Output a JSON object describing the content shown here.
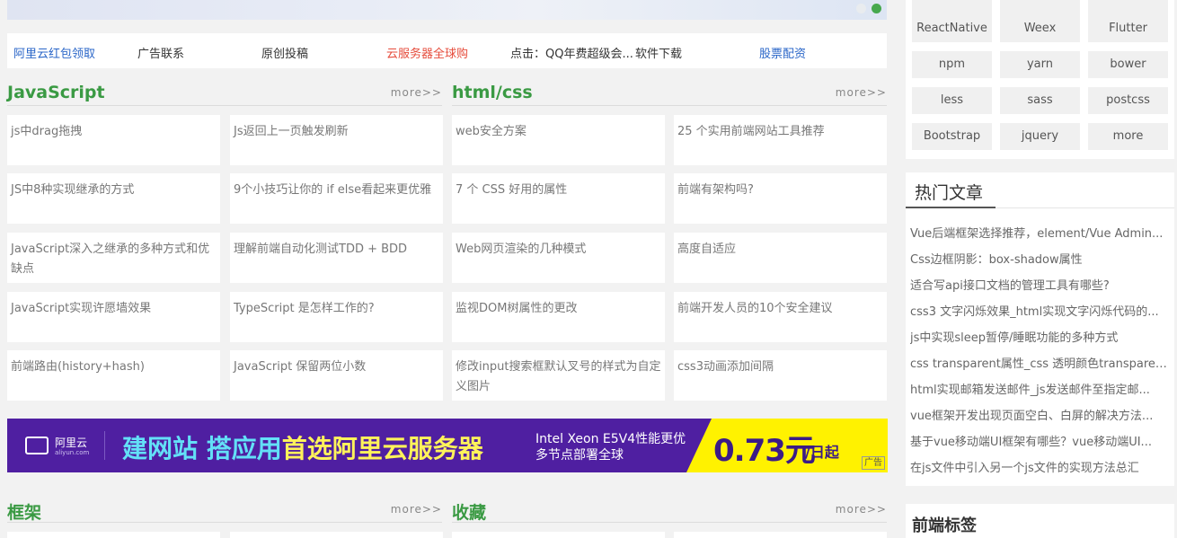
{
  "carousel": {
    "dots": 2,
    "active_dot": 2
  },
  "linkbar": {
    "links": [
      {
        "label": "阿里云红包领取",
        "color": "#2a66c8"
      },
      {
        "label": "广告联系",
        "color": "#333333"
      },
      {
        "label": "原创投稿",
        "color": "#333333"
      },
      {
        "label": "云服务器全球购",
        "color": "#e64c3c"
      },
      {
        "label": "点击：QQ年费超级会...",
        "color": "#333333"
      },
      {
        "label": "软件下载",
        "color": "#333333"
      },
      {
        "label": "股票配资",
        "color": "#2a66c8"
      }
    ]
  },
  "sections": {
    "javascript": {
      "title": "JavaScript",
      "more": "more>>"
    },
    "htmlcss": {
      "title": "html/css",
      "more": "more>>"
    },
    "framework": {
      "title": "框架",
      "more": "more>>"
    },
    "favorites": {
      "title": "收藏",
      "more": "more>>"
    }
  },
  "javascript_articles": [
    "js中drag拖拽",
    "Js返回上一页触发刷新",
    "JS中8种实现继承的方式",
    "9个小技巧让你的 if else看起来更优雅",
    "JavaScript深入之继承的多种方式和优缺点",
    "理解前端自动化测试TDD + BDD",
    "JavaScript实现许愿墙效果",
    "TypeScript 是怎样工作的?",
    "前端路由(history+hash)",
    "JavaScript 保留两位小数"
  ],
  "htmlcss_articles": [
    "web安全方案",
    "25 个实用前端网站工具推荐",
    "7 个 CSS 好用的属性",
    "前端有架构吗?",
    "Web网页渲染的几种模式",
    "高度自适应",
    "监视DOM树属性的更改",
    "前端开发人员的10个安全建议",
    "修改input搜索框默认叉号的样式为自定义图片",
    "css3动画添加间隔"
  ],
  "ad": {
    "logo_text": "阿里云",
    "logo_sub": "aliyun.com",
    "headline_a": "建网站 搭应用",
    "headline_b": "首选阿里云服务器",
    "spec_line1": "Intel Xeon E5V4性能更优",
    "spec_line2": "多节点部署全球",
    "price": "0.73元",
    "unit": "/日起",
    "tag": "广告",
    "colors": {
      "bg": "#4f1fa1",
      "cyan": "#63e0f7",
      "yellow": "#fff200"
    }
  },
  "sidebar": {
    "tags": [
      "ReactNative",
      "Weex",
      "Flutter",
      "npm",
      "yarn",
      "bower",
      "less",
      "sass",
      "postcss",
      "Bootstrap",
      "jquery",
      "more"
    ],
    "hot": {
      "title": "热门文章",
      "items": [
        "Vue后端框架选择推荐，element/Vue Admin...",
        "Css边框阴影：box-shadow属性",
        "适合写api接口文档的管理工具有哪些?",
        "css3 文字闪烁效果_html实现文字闪烁代码的...",
        "js中实现sleep暂停/睡眠功能的多种方式",
        "css transparent属性_css 透明颜色transparent...",
        "html实现邮箱发送邮件_js发送邮件至指定邮...",
        "vue框架开发出现页面空白、白屏的解决方法...",
        "基于vue移动端UI框架有哪些？vue移动端UI...",
        "在js文件中引入另一个js文件的实现方法总汇"
      ]
    },
    "tags_title": "前端标签"
  },
  "theme": {
    "accent_green": "#3a9a43"
  }
}
